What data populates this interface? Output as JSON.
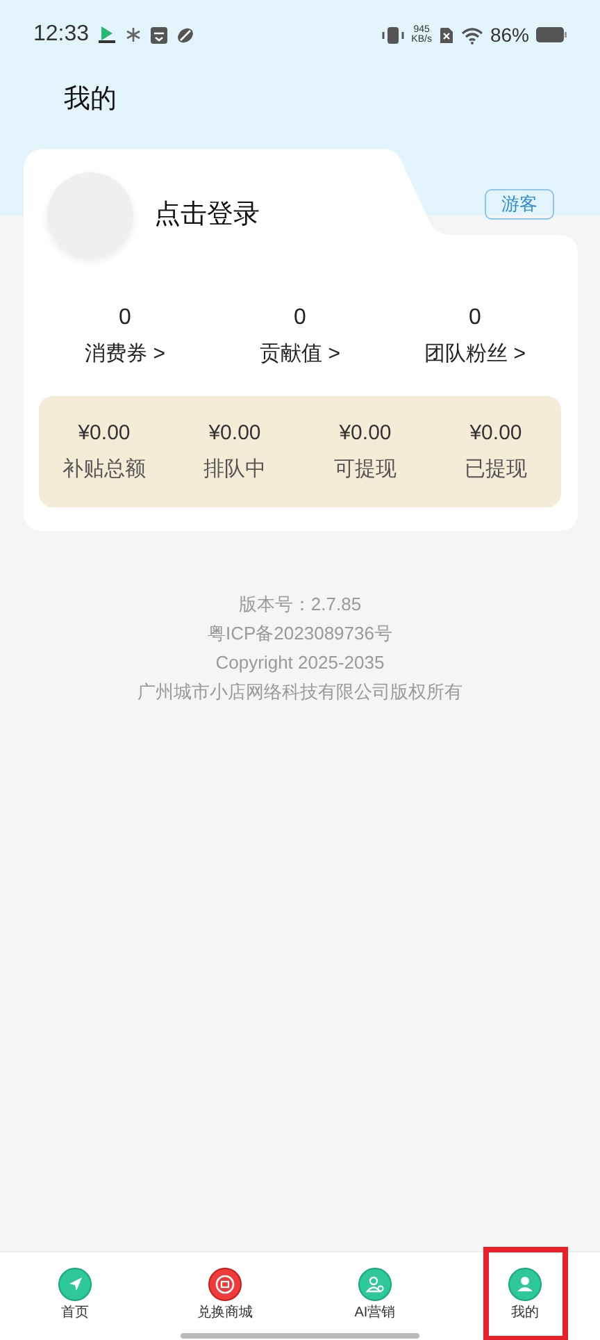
{
  "status_bar": {
    "time": "12:33",
    "net_speed": "945",
    "net_unit": "KB/s",
    "battery": "86%"
  },
  "header": {
    "title": "我的"
  },
  "profile": {
    "login": "点击登录",
    "badge": "游客"
  },
  "stats": [
    {
      "value": "0",
      "label": "消费券 >"
    },
    {
      "value": "0",
      "label": "贡献值 >"
    },
    {
      "value": "0",
      "label": "团队粉丝 >"
    }
  ],
  "earnings": [
    {
      "value": "¥0.00",
      "label": "补贴总额"
    },
    {
      "value": "¥0.00",
      "label": "排队中"
    },
    {
      "value": "¥0.00",
      "label": "可提现"
    },
    {
      "value": "¥0.00",
      "label": "已提现"
    }
  ],
  "footer": [
    "版本号：2.7.85",
    "粤ICP备2023089736号",
    "Copyright 2025-2035",
    "广州城市小店网络科技有限公司版权所有"
  ],
  "tab_bar": [
    {
      "kind": "home",
      "label": "首页",
      "highlighted": false
    },
    {
      "kind": "mall",
      "label": "兑换商城",
      "highlighted": false
    },
    {
      "kind": "ai",
      "label": "AI营销",
      "highlighted": false
    },
    {
      "kind": "me",
      "label": "我的",
      "highlighted": true
    }
  ]
}
